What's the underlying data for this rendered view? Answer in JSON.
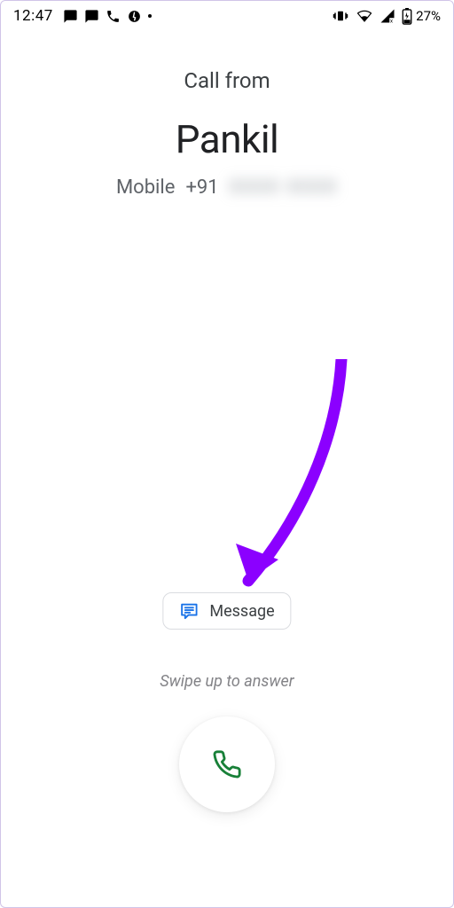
{
  "status": {
    "time": "12:47",
    "battery_text": "27%"
  },
  "call": {
    "call_from_label": "Call from",
    "caller_name": "Pankil",
    "line_type": "Mobile",
    "country_code": "+91",
    "redacted_number": "0000 0000"
  },
  "actions": {
    "message_label": "Message"
  },
  "hint": {
    "swipe_text": "Swipe up to answer"
  },
  "icons": {
    "chat": "chat-bubble-icon",
    "phone": "phone-handset-icon"
  },
  "annotation": {
    "arrow_color": "#8b00ff"
  }
}
